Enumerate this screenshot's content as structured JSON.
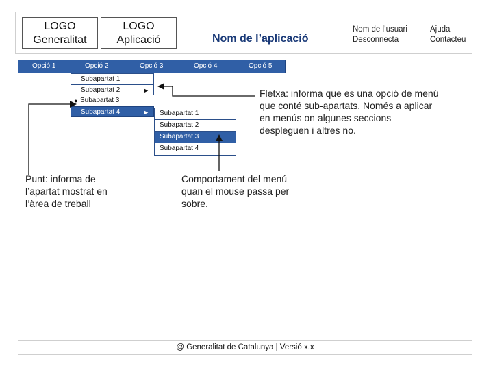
{
  "header": {
    "logo_generalitat": [
      "LOGO",
      "Generalitat"
    ],
    "logo_aplicacio": [
      "LOGO",
      "Aplicació"
    ],
    "app_name": "Nom de l’aplicació",
    "user_name": "Nom de l’usuari",
    "logout": "Desconnecta",
    "help": "Ajuda",
    "contact": "Contacteu"
  },
  "menu": {
    "items": [
      "Opció 1",
      "Opció 2",
      "Opció 3",
      "Opció 4",
      "Opció 5"
    ]
  },
  "submenu1": {
    "items": [
      {
        "label": "Subapartat 1",
        "arrow": "",
        "bullet": ""
      },
      {
        "label": "Subapartat 2",
        "arrow": "►",
        "bullet": ""
      },
      {
        "label": "Subapartat 3",
        "arrow": "",
        "bullet": "●"
      },
      {
        "label": "Subapartat 4",
        "arrow": "►",
        "bullet": ""
      }
    ]
  },
  "submenu2": {
    "items": [
      "Subapartat 1",
      "Subapartat 2",
      "Subapartat 3",
      "Subapartat 4"
    ]
  },
  "notes": {
    "arrow_note": "Fletxa: informa que es una opció de menú que conté sub-apartats. Només a aplicar en menús on algunes seccions despleguen i altres no.",
    "point_note": "Punt: informa de l’apartat mostrat en l’àrea de treball",
    "hover_note": "Comportament del menú quan el mouse passa per sobre."
  },
  "footer": {
    "text": "@ Generalitat de Catalunya | Versió x.x"
  }
}
